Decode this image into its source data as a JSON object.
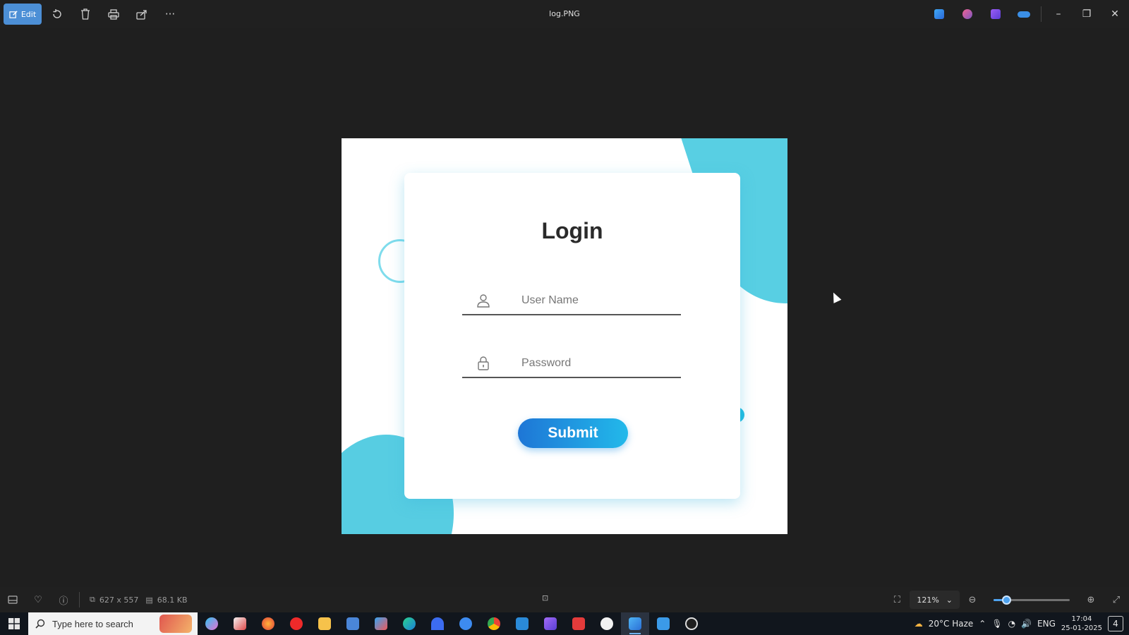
{
  "toolbar": {
    "edit_label": "Edit",
    "window_title": "log.PNG",
    "icons": [
      "edit-icon",
      "rotate-icon",
      "delete-icon",
      "print-icon",
      "share-icon",
      "more-icon"
    ],
    "more_glyph": "···"
  },
  "image_content": {
    "title": "Login",
    "username_placeholder": "User Name",
    "password_placeholder": "Password",
    "submit_label": "Submit",
    "accent_color": "#1fbbe0",
    "blob_color": "#58cfe3"
  },
  "statusbar": {
    "dimensions": "627 x 557",
    "file_size": "68.1 KB",
    "zoom_level": "121%",
    "zoom_slider_fraction": 0.17
  },
  "taskbar": {
    "search_placeholder": "Type here to search",
    "weather": "20°C  Haze",
    "language": "ENG",
    "time": "17:04",
    "date": "25-01-2025",
    "notification_count": "4"
  }
}
